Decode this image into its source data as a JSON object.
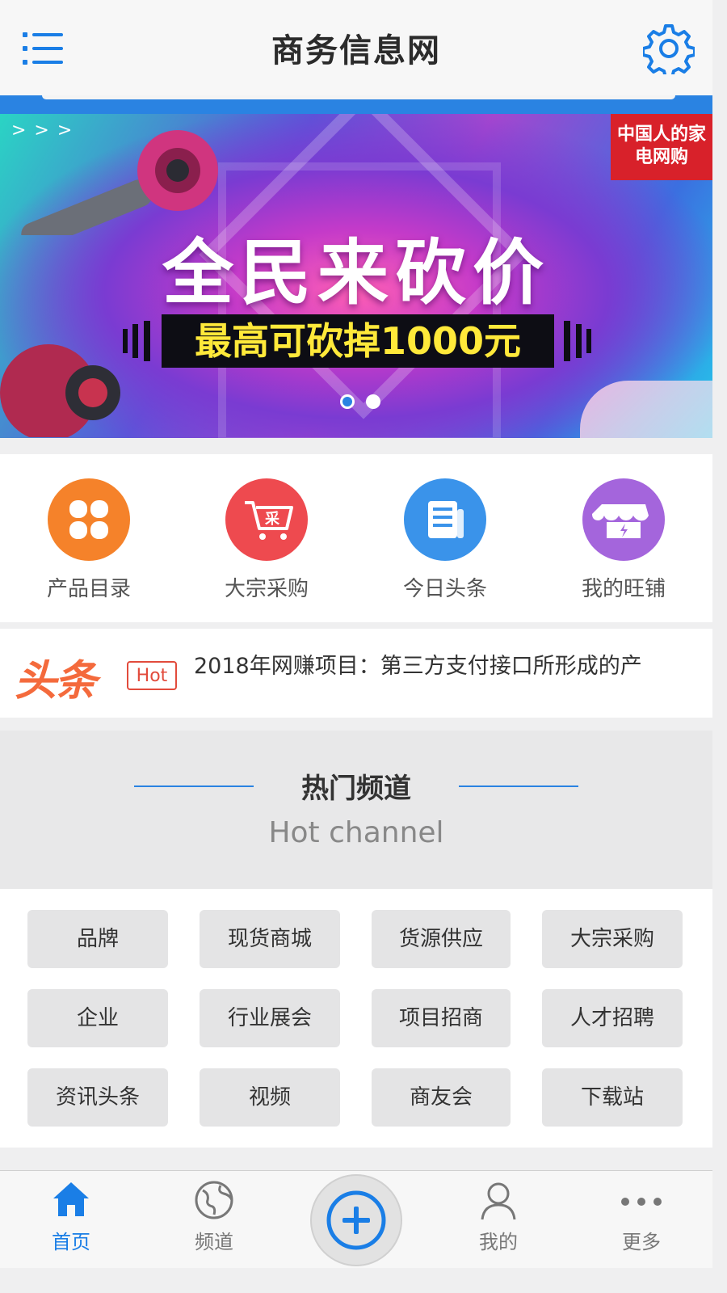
{
  "header": {
    "title": "商务信息网",
    "menu_icon": "menu-icon",
    "settings_icon": "gear-icon"
  },
  "banner": {
    "headline": "全民来砍价",
    "subline": "最高可砍掉1000元",
    "brand_logo_text": "中国人的家电网购",
    "slide_count": 2,
    "active_slide": 1,
    "accent_color": "#2a83e2"
  },
  "shortcuts": [
    {
      "label": "产品目录",
      "icon": "clover-icon",
      "color": "#f5822a"
    },
    {
      "label": "大宗采购",
      "icon": "shopping-cart-icon",
      "color": "#ee4a4f"
    },
    {
      "label": "今日头条",
      "icon": "newspaper-icon",
      "color": "#3a93ea"
    },
    {
      "label": "我的旺铺",
      "icon": "storefront-icon",
      "color": "#a465dc"
    }
  ],
  "headline": {
    "logo": "头条",
    "badge": "Hot",
    "text": "2018年网赚项目：第三方支付接口所形成的产"
  },
  "hot_channel": {
    "title": "热门频道",
    "subtitle": "Hot channel",
    "items": [
      "品牌",
      "现货商城",
      "货源供应",
      "大宗采购",
      "企业",
      "行业展会",
      "项目招商",
      "人才招聘",
      "资讯头条",
      "视频",
      "商友会",
      "下载站"
    ]
  },
  "bottom_nav": {
    "items": [
      {
        "label": "首页",
        "icon": "home-icon",
        "active": true
      },
      {
        "label": "频道",
        "icon": "globe-icon",
        "active": false
      },
      {
        "label": "",
        "icon": "plus-circle-icon",
        "active": false
      },
      {
        "label": "我的",
        "icon": "user-icon",
        "active": false
      },
      {
        "label": "更多",
        "icon": "more-dots-icon",
        "active": false
      }
    ],
    "active_color": "#1a7ee6"
  }
}
